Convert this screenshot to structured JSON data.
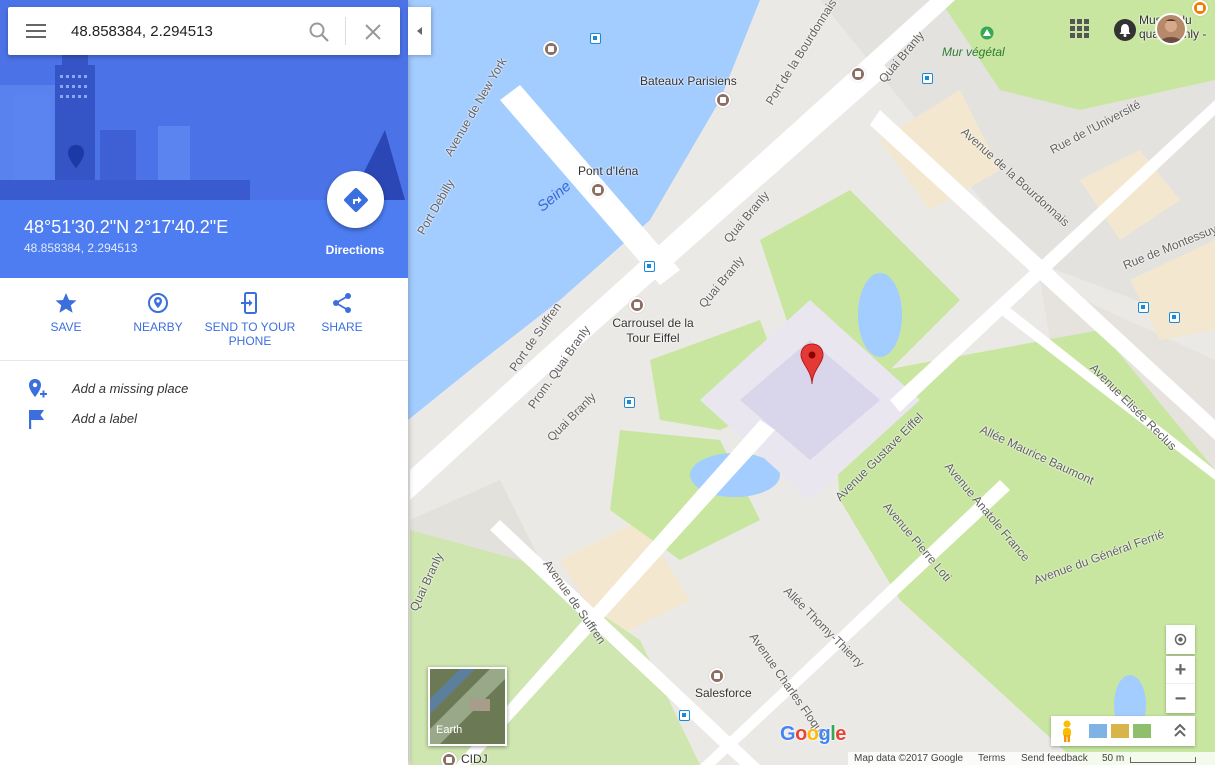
{
  "search": {
    "value": "48.858384, 2.294513",
    "menu_icon": "menu-icon",
    "search_icon": "search-icon",
    "clear_icon": "close-icon"
  },
  "place": {
    "title": "48°51'30.2\"N 2°17'40.2\"E",
    "subtitle": "48.858384, 2.294513",
    "directions_label": "Directions"
  },
  "actions": [
    {
      "label": "SAVE",
      "icon": "star-icon"
    },
    {
      "label": "NEARBY",
      "icon": "nearby-pin-icon"
    },
    {
      "label": "SEND TO YOUR PHONE",
      "icon": "send-to-phone-icon"
    },
    {
      "label": "SHARE",
      "icon": "share-icon"
    }
  ],
  "extras": [
    {
      "label": "Add a missing place",
      "icon": "add-place-icon"
    },
    {
      "label": "Add a label",
      "icon": "flag-icon"
    }
  ],
  "map": {
    "labels": {
      "seine": "Seine",
      "mur_vegetal": "Mur végétal",
      "bateaux": "Bateaux Parisiens",
      "pont_iena": "Pont d'Iéna",
      "carrousel": "Carrousel de la Tour Eiffel",
      "salesforce": "Salesforce",
      "mu_du_q": "Musée du quai Branly - Jacques Chirac",
      "cidj": "CIDJ",
      "av_new_york": "Avenue de New York",
      "port_debilly": "Port Debilly",
      "port_bourdonnais": "Port de la Bourdonnais",
      "quai_branly_1": "Quai Branly",
      "quai_branly_2": "Quai Branly",
      "quai_branly_3": "Quai Branly",
      "quai_branly_4": "Quai Branly",
      "quai_branly_5": "Quai Branly",
      "port_suffren": "Port de Suffren",
      "prom_quai": "Prom. Quai Branly",
      "av_bourdonnais": "Avenue de la Bourdonnais",
      "rue_universite": "Rue de l'Université",
      "rue_montessuy": "Rue de Montessuy",
      "av_elisee": "Avenue Elisée Reclus",
      "allee_baumont": "Allée Maurice Baumont",
      "av_france": "Avenue Anatole France",
      "av_loti": "Avenue Pierre Loti",
      "av_ferrie": "Avenue du Général Ferrié",
      "av_eiffel": "Avenue Gustave Eiffel",
      "allee_thierry": "Allée Thomy-Thierry",
      "av_suffren": "Avenue de Suffren",
      "av_floquet": "Avenue Charles Floquet"
    },
    "earth_label": "Earth",
    "zoom_in": "+",
    "zoom_out": "−",
    "google_logo": "Google",
    "footer": {
      "map_data": "Map data ©2017 Google",
      "terms": "Terms",
      "feedback": "Send feedback",
      "scale": "50 m"
    },
    "colors": {
      "water": "#a3ccff",
      "park": "#c8e6a0",
      "road": "#ffffff",
      "pin": "#e53935"
    }
  }
}
